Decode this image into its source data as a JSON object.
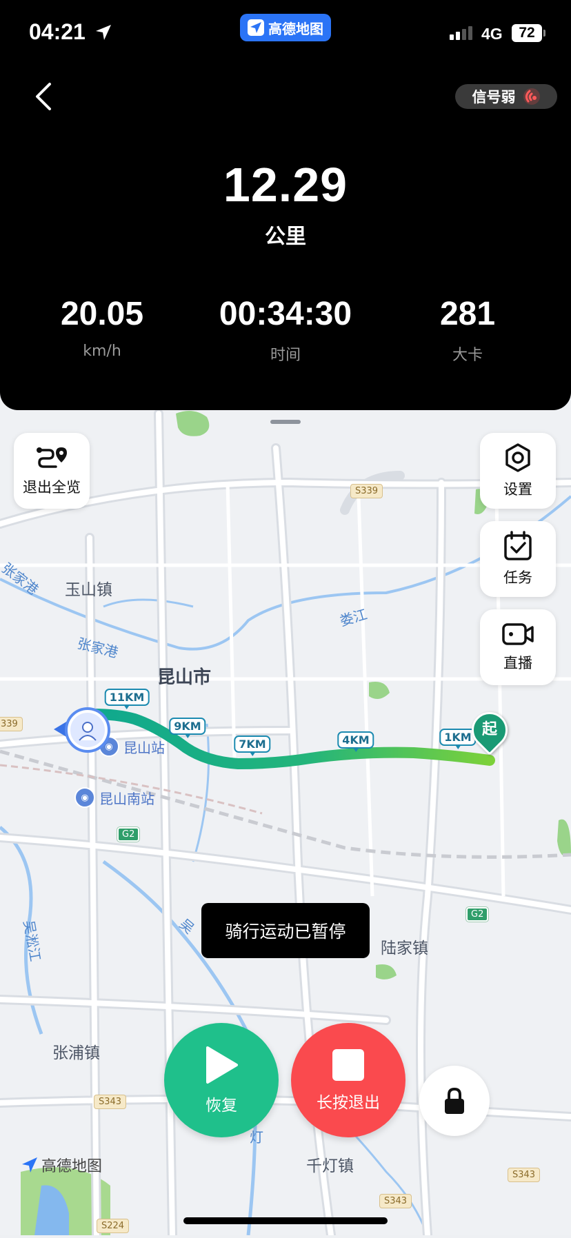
{
  "status_bar": {
    "time": "04:21",
    "network": "4G",
    "battery": "72"
  },
  "app_chip": {
    "label": "高德地图"
  },
  "header": {
    "signal_status": "信号弱"
  },
  "metrics": {
    "distance": {
      "value": "12.29",
      "unit": "公里"
    },
    "speed": {
      "value": "20.05",
      "label": "km/h"
    },
    "duration": {
      "value": "00:34:30",
      "label": "时间"
    },
    "calories": {
      "value": "281",
      "label": "大卡"
    }
  },
  "controls": {
    "overview": "退出全览",
    "settings": "设置",
    "tasks": "任务",
    "live": "直播"
  },
  "toast": "骑行运动已暂停",
  "actions": {
    "resume": "恢复",
    "exit": "长按退出"
  },
  "route_markers": {
    "km11": "11KM",
    "km9": "9KM",
    "km7": "7KM",
    "km4": "4KM",
    "km1": "1KM",
    "start": "起"
  },
  "map_labels": {
    "yushan": "玉山镇",
    "kunshan": "昆山市",
    "zhangjiagang_1": "张家港",
    "zhangjiagang_2": "张家港",
    "loujiang": "娄江",
    "kunshan_station": "昆山站",
    "kunshan_south": "昆山南站",
    "lujia": "陆家镇",
    "zhangpu": "张浦镇",
    "qiandeng": "千灯镇",
    "wusong_1": "吴淞江",
    "wusong_2": "吴",
    "wusong_3": "灯",
    "s339": "S339",
    "s339_left": "339",
    "s343_a": "S343",
    "s343_b": "S343",
    "s343_c": "S343",
    "s224": "S224",
    "g2_a": "G2",
    "g2_b": "G2"
  },
  "watermark": "高德地图",
  "colors": {
    "resume": "#1fc08b",
    "exit": "#fa4a4e",
    "route_start": "#7cd13a",
    "route_end": "#0fa88e"
  }
}
